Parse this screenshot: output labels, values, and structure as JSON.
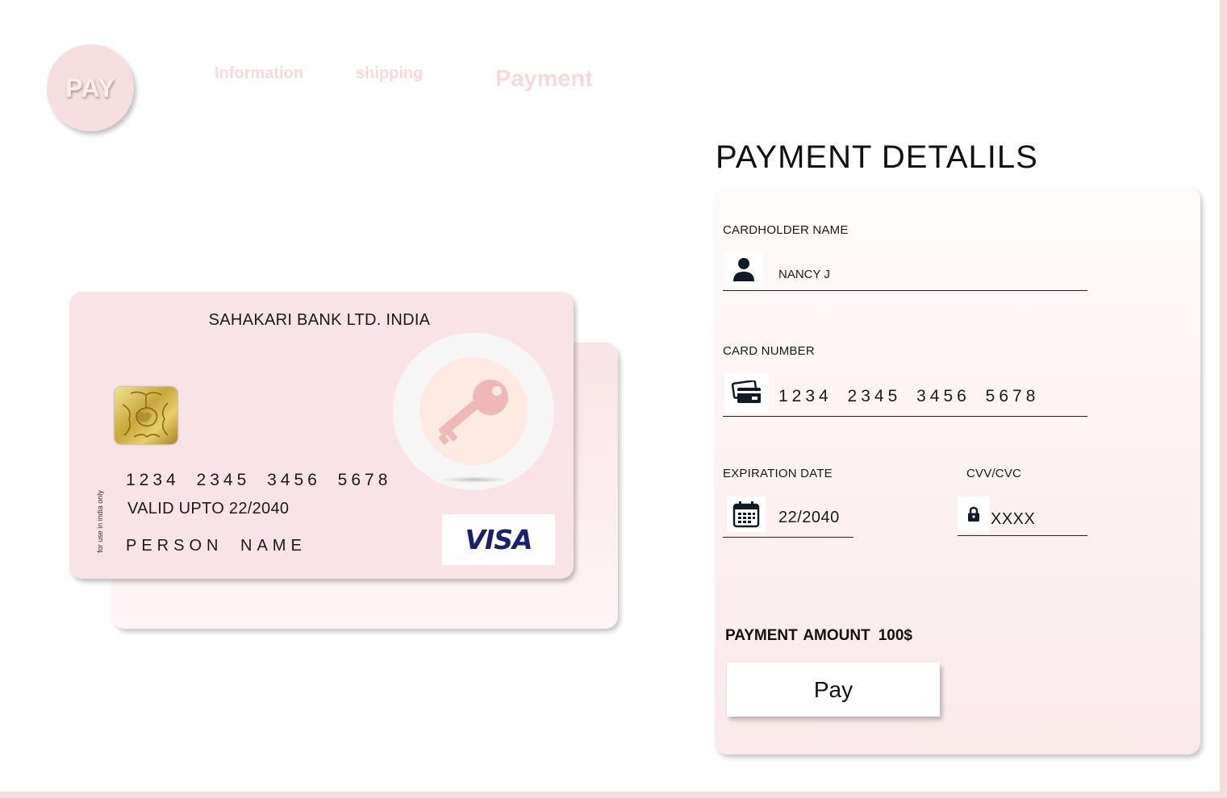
{
  "header": {
    "logo": "PAY",
    "steps": [
      "Information",
      "shipping",
      "Payment"
    ]
  },
  "card": {
    "bank_name": "SAHAKARI BANK LTD. INDIA",
    "number": "1234  2345  3456  5678",
    "valid_upto": "VALID UPTO  22/2040",
    "holder": "PERSON  NAME",
    "side_text": "for use in india only",
    "network": "VISA",
    "chip_icon": "sim-chip-icon",
    "key_icon": "key-icon"
  },
  "form": {
    "title": "PAYMENT DETALILS",
    "cardholder": {
      "label": "CARDHOLDER NAME",
      "value": "NANCY J",
      "icon": "user-icon"
    },
    "card_number": {
      "label": "CARD NUMBER",
      "value": "1234  2345  3456  5678",
      "icon": "credit-card-icon"
    },
    "expiration": {
      "label": "EXPIRATION DATE",
      "value": "22/2040",
      "icon": "calendar-icon"
    },
    "cvv": {
      "label": "CVV/CVC",
      "value": "XXXX",
      "icon": "lock-icon"
    },
    "amount_label": "PAYMENT AMOUNT",
    "amount_value": "100$",
    "pay_button": "Pay"
  },
  "colors": {
    "accent_pink": "#f8e4e6",
    "step_text": "#f7d9dc",
    "visa_blue": "#1a1f71"
  }
}
